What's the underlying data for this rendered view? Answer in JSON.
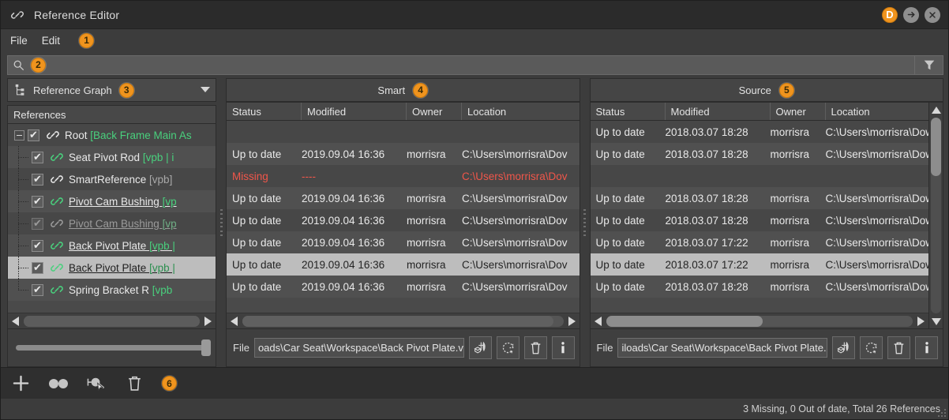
{
  "window": {
    "title": "Reference Editor",
    "icon": "link-icon",
    "controls": {
      "d_badge": "D",
      "detach": "arrow-right-circle-icon",
      "close": "close-circle-icon"
    }
  },
  "menu": {
    "items": [
      "File",
      "Edit"
    ],
    "badge": "1"
  },
  "search": {
    "placeholder": "",
    "value": "",
    "icon": "search-icon",
    "badge": "2",
    "filter_icon": "filter-funnel-icon"
  },
  "refs_panel": {
    "combo": {
      "label": "Reference Graph",
      "badge": "3",
      "icon": "graph-icon",
      "arrow": "chevron-down-icon"
    },
    "column_header": "References",
    "rows": [
      {
        "indent": 0,
        "twisty": "minus",
        "checked": true,
        "chain": "white",
        "name": "Root ",
        "tag": "[Back Frame Main As",
        "underline": false,
        "dim": false,
        "selected": false
      },
      {
        "indent": 1,
        "twisty": "",
        "checked": true,
        "chain": "green",
        "name": "Seat Pivot Rod ",
        "tag": "[vpb | i",
        "underline": false,
        "dim": false,
        "selected": false
      },
      {
        "indent": 1,
        "twisty": "",
        "checked": true,
        "chain": "white",
        "name": "SmartReference ",
        "tag": "[vpb]",
        "underline": false,
        "dim": false,
        "selected": false,
        "tag_gray": true
      },
      {
        "indent": 1,
        "twisty": "",
        "checked": true,
        "chain": "green",
        "name": "Pivot Cam Bushing ",
        "tag": "[vp",
        "underline": true,
        "dim": false,
        "selected": false
      },
      {
        "indent": 1,
        "twisty": "",
        "checked": true,
        "chain": "gray",
        "name": "Pivot Cam Bushing ",
        "tag": "[vp",
        "underline": true,
        "dim": true,
        "selected": false
      },
      {
        "indent": 1,
        "twisty": "",
        "checked": true,
        "chain": "green",
        "name": "Back Pivot Plate ",
        "tag": "[vpb |",
        "underline": true,
        "dim": false,
        "selected": false
      },
      {
        "indent": 1,
        "twisty": "",
        "checked": true,
        "chain": "green",
        "name": "Back Pivot Plate ",
        "tag": "[vpb |",
        "underline": true,
        "dim": false,
        "selected": true
      },
      {
        "indent": 1,
        "twisty": "",
        "checked": true,
        "chain": "green",
        "name": "Spring Bracket R ",
        "tag": "[vpb",
        "underline": false,
        "dim": false,
        "selected": false
      }
    ],
    "hscroll": {
      "left_arrow": "caret-left-icon",
      "right_arrow": "caret-right-icon",
      "thumb_pct": 100
    },
    "slider": {
      "value_pct": 100
    }
  },
  "smart_panel": {
    "title": "Smart",
    "badge": "4",
    "columns": [
      "Status",
      "Modified",
      "Owner",
      "Location"
    ],
    "rows": [
      {
        "status": "",
        "modified": "",
        "owner": "",
        "location": "",
        "missing": false,
        "selected": false,
        "empty": true
      },
      {
        "status": "Up to date",
        "modified": "2019.09.04 16:36",
        "owner": "morrisra",
        "location": "C:\\Users\\morrisra\\Dov",
        "missing": false,
        "selected": false
      },
      {
        "status": "Missing",
        "modified": "----",
        "owner": "",
        "location": "C:\\Users\\morrisra\\Dov",
        "missing": true,
        "selected": false
      },
      {
        "status": "Up to date",
        "modified": "2019.09.04 16:36",
        "owner": "morrisra",
        "location": "C:\\Users\\morrisra\\Dov",
        "missing": false,
        "selected": false
      },
      {
        "status": "Up to date",
        "modified": "2019.09.04 16:36",
        "owner": "morrisra",
        "location": "C:\\Users\\morrisra\\Dov",
        "missing": false,
        "selected": false
      },
      {
        "status": "Up to date",
        "modified": "2019.09.04 16:36",
        "owner": "morrisra",
        "location": "C:\\Users\\morrisra\\Dov",
        "missing": false,
        "selected": false
      },
      {
        "status": "Up to date",
        "modified": "2019.09.04 16:36",
        "owner": "morrisra",
        "location": "C:\\Users\\morrisra\\Dov",
        "missing": false,
        "selected": true
      },
      {
        "status": "Up to date",
        "modified": "2019.09.04 16:36",
        "owner": "morrisra",
        "location": "C:\\Users\\morrisra\\Dov",
        "missing": false,
        "selected": false
      }
    ],
    "hscroll": {
      "thumb_pct": 97
    },
    "filebar": {
      "label": "File",
      "value": "oads\\Car Seat\\Workspace\\Back Pivot Plate.vpb",
      "buttons": [
        "load-reference-icon",
        "reload-reference-icon",
        "delete-reference-icon",
        "reference-info-icon"
      ]
    }
  },
  "source_panel": {
    "title": "Source",
    "badge": "5",
    "columns": [
      "Status",
      "Modified",
      "Owner",
      "Location"
    ],
    "rows": [
      {
        "status": "Up to date",
        "modified": "2018.03.07 18:28",
        "owner": "morrisra",
        "location": "C:\\Users\\morrisra\\Dowr",
        "missing": false,
        "selected": false
      },
      {
        "status": "Up to date",
        "modified": "2018.03.07 18:28",
        "owner": "morrisra",
        "location": "C:\\Users\\morrisra\\Dowr",
        "missing": false,
        "selected": false
      },
      {
        "status": "",
        "modified": "",
        "owner": "",
        "location": "",
        "missing": false,
        "selected": false,
        "empty": true
      },
      {
        "status": "Up to date",
        "modified": "2018.03.07 18:28",
        "owner": "morrisra",
        "location": "C:\\Users\\morrisra\\Dowr",
        "missing": false,
        "selected": false
      },
      {
        "status": "Up to date",
        "modified": "2018.03.07 18:28",
        "owner": "morrisra",
        "location": "C:\\Users\\morrisra\\Dowr",
        "missing": false,
        "selected": false
      },
      {
        "status": "Up to date",
        "modified": "2018.03.07 17:22",
        "owner": "morrisra",
        "location": "C:\\Users\\morrisra\\Dowr",
        "missing": false,
        "selected": false
      },
      {
        "status": "Up to date",
        "modified": "2018.03.07 17:22",
        "owner": "morrisra",
        "location": "C:\\Users\\morrisra\\Dowr",
        "missing": false,
        "selected": true
      },
      {
        "status": "Up to date",
        "modified": "2018.03.07 18:28",
        "owner": "morrisra",
        "location": "C:\\Users\\morrisra\\Dowr",
        "missing": false,
        "selected": false
      }
    ],
    "vscroll": {
      "up_arrow": "caret-up-icon",
      "down_arrow": "caret-down-icon",
      "thumb_pct": 30
    },
    "hscroll": {
      "thumb_pct": 51
    },
    "filebar": {
      "label": "File",
      "value": "iloads\\Car Seat\\Workspace\\Back Pivot Plate.ipt",
      "buttons": [
        "load-reference-icon",
        "reload-reference-icon",
        "delete-reference-icon",
        "reference-info-icon"
      ]
    }
  },
  "toolbar": {
    "buttons": [
      "add-reference-icon",
      "duplicate-reference-icon",
      "select-reference-icon",
      "delete-reference-icon"
    ],
    "badge": "6"
  },
  "statusbar": {
    "text": "3 Missing, 0 Out of date, Total 26 References"
  },
  "colors": {
    "accent_orange": "#f0941e",
    "green_link": "#49d07d",
    "missing_red": "#f0564a",
    "window_bg": "#3c3c3c",
    "titlebar_bg": "#2b2b2b",
    "selection_bg": "#bdbdbd"
  }
}
